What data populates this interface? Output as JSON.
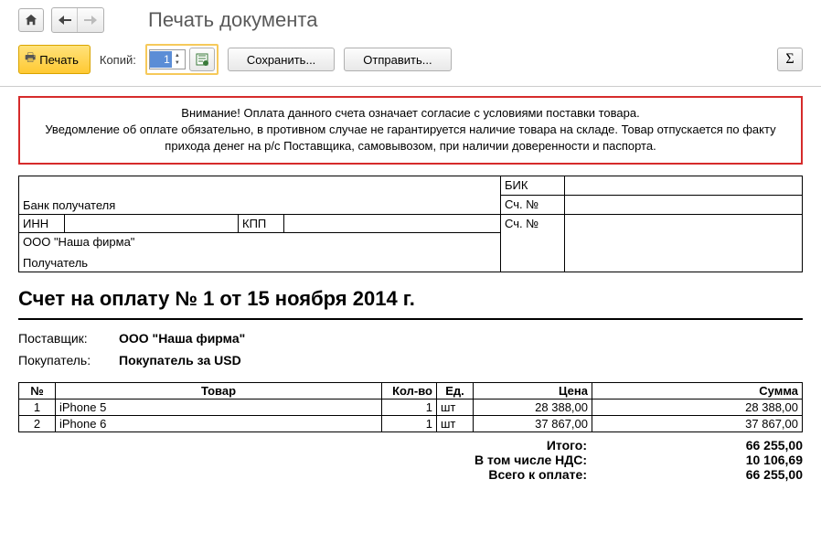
{
  "header": {
    "page_title": "Печать документа"
  },
  "toolbar": {
    "print_label": "Печать",
    "copies_label": "Копий:",
    "copies_value": "1",
    "save_label": "Сохранить...",
    "send_label": "Отправить..."
  },
  "warning": {
    "line1": "Внимание! Оплата данного счета означает согласие с условиями поставки товара.",
    "line2": "Уведомление об оплате обязательно, в противном случае не гарантируется наличие товара на складе. Товар отпускается по факту прихода денег на р/с Поставщика, самовывозом, при наличии доверенности и паспорта."
  },
  "bank": {
    "bik_label": "БИК",
    "bank_acc_label": "Сч. №",
    "bank_recipient_label": "Банк получателя",
    "inn_label": "ИНН",
    "kpp_label": "КПП",
    "payee_acc_label": "Сч. №",
    "company_name": "ООО \"Наша фирма\"",
    "recipient_label": "Получатель"
  },
  "document": {
    "title": "Счет на оплату № 1 от 15 ноября 2014 г.",
    "supplier_label": "Поставщик:",
    "supplier_value": "ООО \"Наша фирма\"",
    "buyer_label": "Покупатель:",
    "buyer_value": "Покупатель за USD"
  },
  "table": {
    "headers": {
      "num": "№",
      "product": "Товар",
      "qty": "Кол-во",
      "unit": "Ед.",
      "price": "Цена",
      "sum": "Сумма"
    },
    "rows": [
      {
        "num": "1",
        "product": "iPhone 5",
        "qty": "1",
        "unit": "шт",
        "price": "28 388,00",
        "sum": "28 388,00"
      },
      {
        "num": "2",
        "product": "iPhone 6",
        "qty": "1",
        "unit": "шт",
        "price": "37 867,00",
        "sum": "37 867,00"
      }
    ]
  },
  "totals": {
    "total_label": "Итого:",
    "total_value": "66 255,00",
    "vat_label": "В том числе НДС:",
    "vat_value": "10 106,69",
    "grand_label": "Всего к оплате:",
    "grand_value": "66 255,00"
  }
}
